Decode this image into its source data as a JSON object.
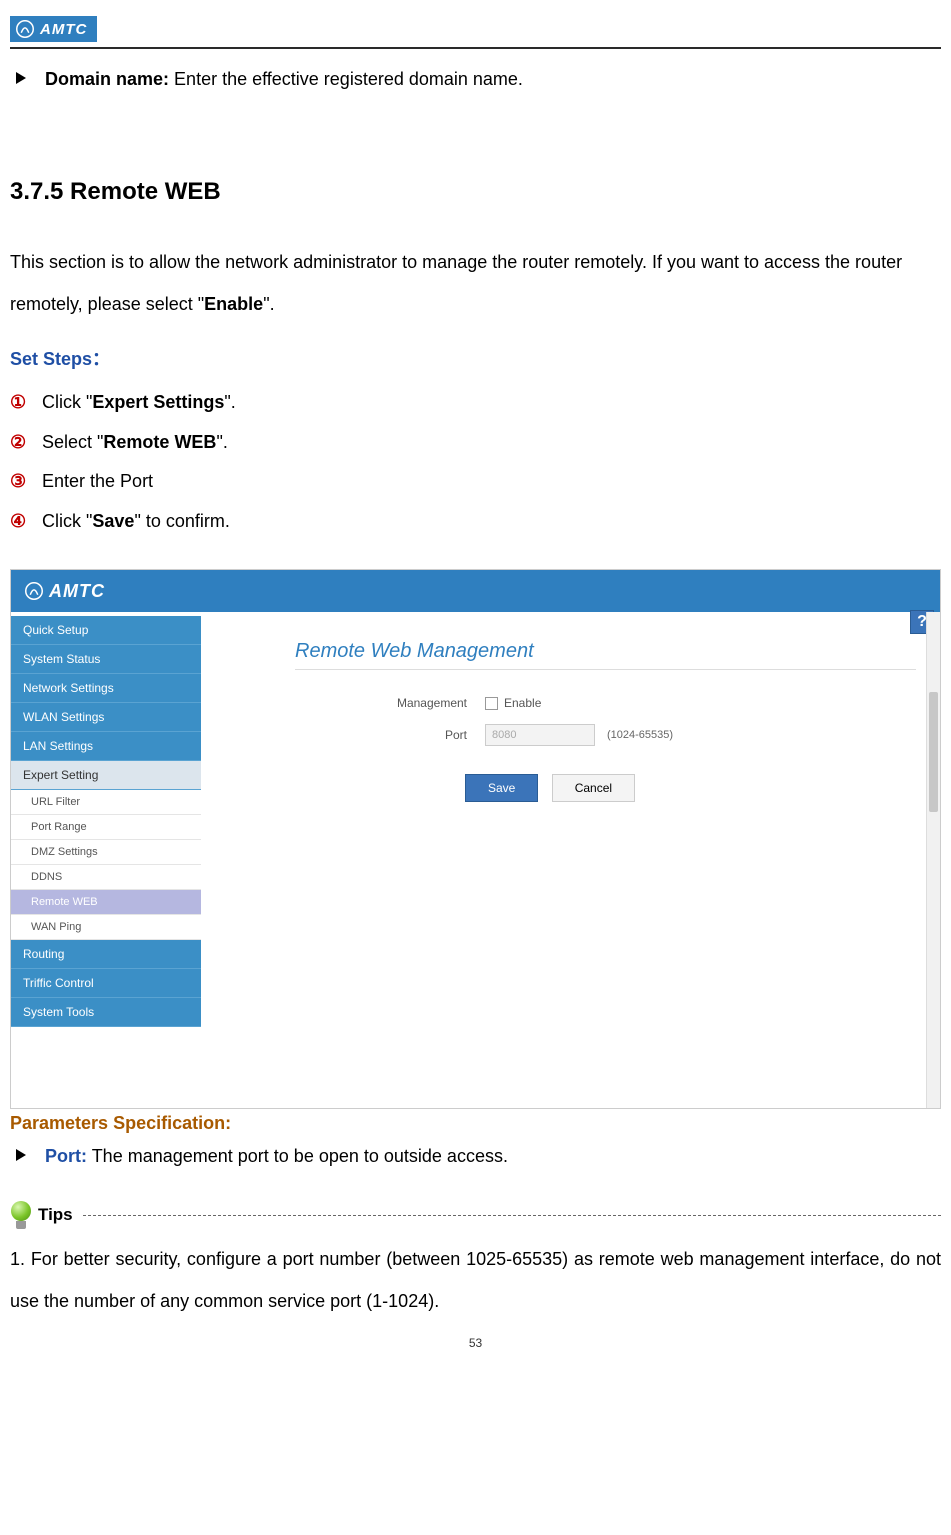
{
  "brand": "AMTC",
  "top_definition": {
    "term": "Domain name:",
    "desc": " Enter the effective registered domain name."
  },
  "section_heading": "3.7.5 Remote WEB",
  "intro_pre": "This section is to allow the network administrator to manage the router remotely. If you want to access the router remotely, please select \"",
  "intro_bold": "Enable",
  "intro_post": "\".",
  "set_steps_label": "Set Steps：",
  "steps": [
    {
      "num": "①",
      "pre": "Click \"",
      "bold": "Expert Settings",
      "post": "\"."
    },
    {
      "num": "②",
      "pre": "Select \"",
      "bold": "Remote WEB",
      "post": "\"."
    },
    {
      "num": "③",
      "pre": "Enter the Port",
      "bold": "",
      "post": ""
    },
    {
      "num": "④",
      "pre": "Click \"",
      "bold": "Save",
      "post": "\" to confirm."
    }
  ],
  "webui": {
    "pane_title": "Remote Web Management",
    "nav_main": [
      "Quick Setup",
      "System Status",
      "Network Settings",
      "WLAN Settings",
      "LAN Settings",
      "Expert Setting"
    ],
    "nav_sub": [
      "URL Filter",
      "Port Range",
      "DMZ Settings",
      "DDNS",
      "Remote WEB",
      "WAN Ping"
    ],
    "nav_tail": [
      "Routing",
      "Triffic Control",
      "System Tools"
    ],
    "active_sub": "Remote WEB",
    "labels": {
      "management": "Management",
      "enable": "Enable",
      "port": "Port",
      "port_value": "8080",
      "port_hint": "(1024-65535)",
      "save": "Save",
      "cancel": "Cancel"
    },
    "help": "?"
  },
  "params_title": "Parameters Specification:",
  "param_port": {
    "key": "Port:",
    "desc": " The management port to be open to outside access."
  },
  "tips_label": "Tips",
  "tip_text": "1.  For  better  security,  configure  a  port  number  (between  1025-65535)  as  remote  web management interface, do not use the number of any common service port (1-1024).",
  "page_number": "53"
}
